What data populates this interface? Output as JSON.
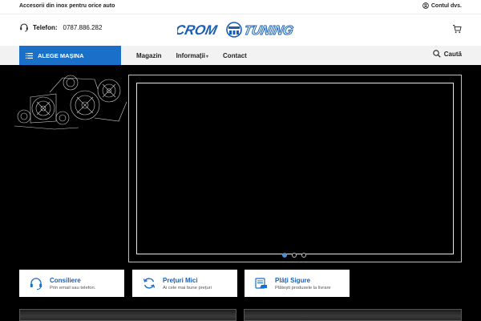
{
  "topbar": {
    "tagline": "Accesorii din inox pentru orice auto",
    "account_label": "Contul dvs."
  },
  "header": {
    "phone_label": "Telefon:",
    "phone_number": "0787.886.282",
    "logo_text_left": "CROM",
    "logo_text_right": "TUNING"
  },
  "nav": {
    "choose_car": "ALEGE MAȘINA",
    "links": [
      "Magazin",
      "Informații",
      "Contact"
    ],
    "search_label": "Caută"
  },
  "slider": {
    "slide_count": 3,
    "active_index": 0
  },
  "features": [
    {
      "title": "Consiliere",
      "subtitle": "Prin email sau telefon.",
      "icon": "headset-icon"
    },
    {
      "title": "Prețuri Mici",
      "subtitle": "Ai cele mai bune prețuri",
      "icon": "refresh-icon"
    },
    {
      "title": "Plăți Sigure",
      "subtitle": "Plătești produsele la livrare",
      "icon": "payment-icon"
    }
  ],
  "colors": {
    "accent": "#1a6fc9",
    "hero_bg": "#000000",
    "feature_title": "#1a5fb4"
  }
}
